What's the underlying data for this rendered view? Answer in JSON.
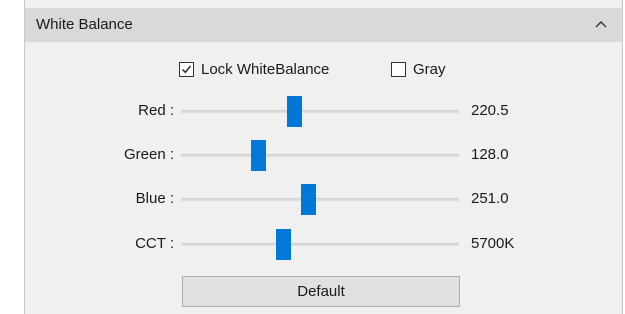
{
  "panel": {
    "title": "White Balance",
    "collapse_icon": "chevron-up-icon"
  },
  "options": {
    "lock_label": "Lock WhiteBalance",
    "lock_checked": true,
    "gray_label": "Gray",
    "gray_checked": false
  },
  "sliders": [
    {
      "label": "Red :",
      "value": "220.5",
      "fraction": 0.41
    },
    {
      "label": "Green :",
      "value": "128.0",
      "fraction": 0.28
    },
    {
      "label": "Blue :",
      "value": "251.0",
      "fraction": 0.46
    },
    {
      "label": "CCT :",
      "value": "5700K",
      "fraction": 0.37
    }
  ],
  "default_label": "Default",
  "colors": {
    "accent": "#0078d7",
    "header_bg": "#d9d9d9",
    "panel_bg": "#f0f0f0"
  }
}
